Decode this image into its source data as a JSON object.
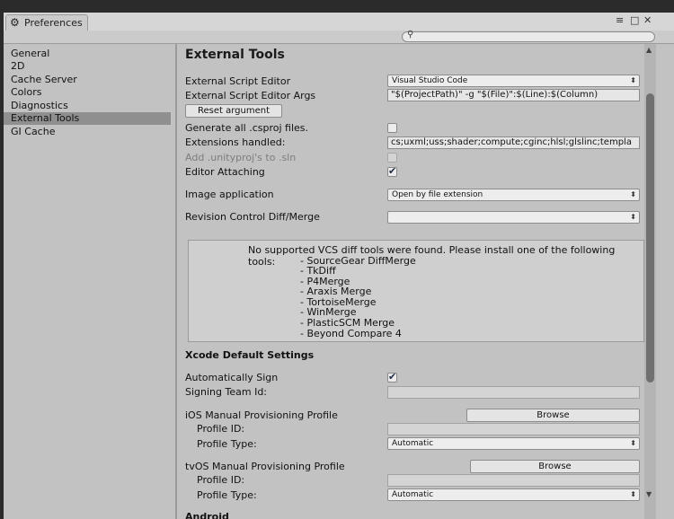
{
  "window": {
    "title": "Preferences",
    "controls": [
      "≡",
      "□",
      "✕"
    ]
  },
  "sidebar": {
    "items": [
      {
        "label": "General"
      },
      {
        "label": "2D"
      },
      {
        "label": "Cache Server"
      },
      {
        "label": "Colors"
      },
      {
        "label": "Diagnostics"
      },
      {
        "label": "External Tools",
        "selected": true
      },
      {
        "label": "GI Cache"
      }
    ]
  },
  "content": {
    "title": "External Tools",
    "script_editor": {
      "label": "External Script Editor",
      "value": "Visual Studio Code"
    },
    "script_editor_args": {
      "label": "External Script Editor Args",
      "value": "\"$(ProjectPath)\" -g \"$(File)\":$(Line):$(Column)"
    },
    "reset_button": "Reset argument",
    "generate_csproj": {
      "label": "Generate all .csproj files.",
      "checked": false
    },
    "extensions": {
      "label": "Extensions handled:",
      "value": "cs;uxml;uss;shader;compute;cginc;hlsl;glslinc;templa"
    },
    "add_unityproj": {
      "label": "Add .unityproj's to .sln",
      "checked": false,
      "disabled": true
    },
    "editor_attaching": {
      "label": "Editor Attaching",
      "checked": true
    },
    "image_app": {
      "label": "Image application",
      "value": "Open by file extension"
    },
    "revision_control": {
      "label": "Revision Control Diff/Merge",
      "value": ""
    },
    "vcs_message": "No supported VCS diff tools were found. Please install one of the following tools:",
    "vcs_tools": [
      "- SourceGear DiffMerge",
      "- TkDiff",
      "- P4Merge",
      "- Araxis Merge",
      "- TortoiseMerge",
      "- WinMerge",
      "- PlasticSCM Merge",
      "- Beyond Compare 4"
    ],
    "xcode": {
      "header": "Xcode Default Settings",
      "auto_sign": {
        "label": "Automatically Sign",
        "checked": true
      },
      "signing_team": {
        "label": "Signing Team Id:",
        "value": ""
      },
      "ios": {
        "label": "iOS Manual Provisioning Profile",
        "browse": "Browse",
        "profile_id_label": "Profile ID:",
        "profile_id_value": "",
        "profile_type_label": "Profile Type:",
        "profile_type_value": "Automatic"
      },
      "tvos": {
        "label": "tvOS Manual Provisioning Profile",
        "browse": "Browse",
        "profile_id_label": "Profile ID:",
        "profile_id_value": "",
        "profile_type_label": "Profile Type:",
        "profile_type_value": "Automatic"
      }
    },
    "android_header": "Android"
  },
  "colors": {
    "panel_bg": "#c2c2c2",
    "selected_bg": "#8f8f8f",
    "checkmark": "#1f2a44"
  }
}
